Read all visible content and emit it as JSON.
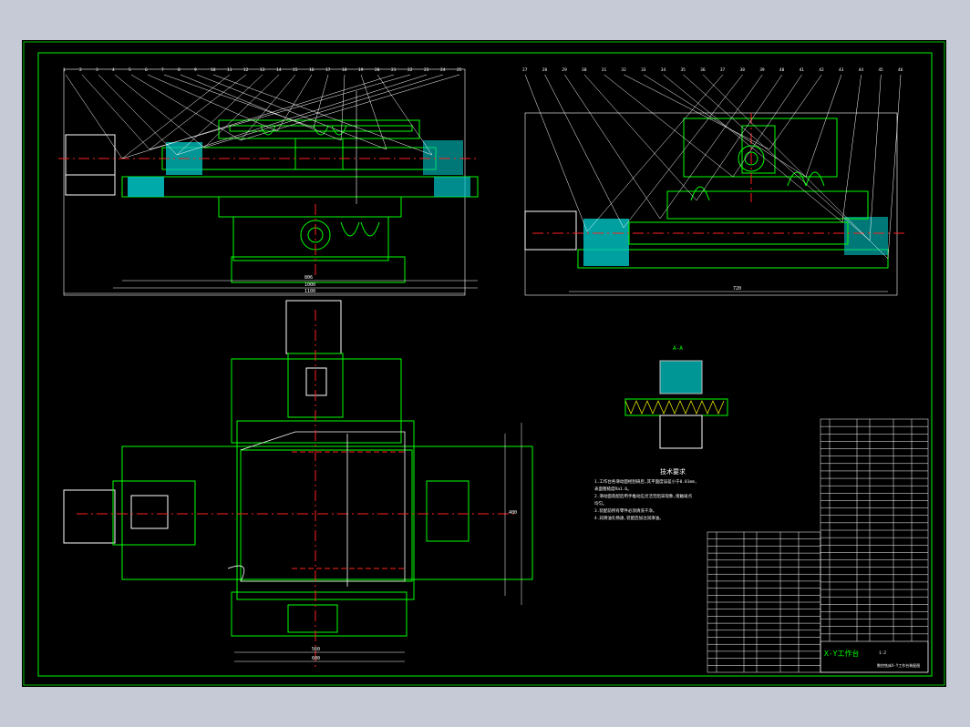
{
  "drawing": {
    "tech_requirements": {
      "heading": "技术要求",
      "lines": [
        "1.工作台各滑动面经刮研后,其平面度误差小于0.01mm,",
        "表面粗糙度Ra1.6。",
        "2.滑动面装配后用手推动应灵活无阻滞现象,接触斑点",
        "均匀。",
        "3.装配前所有零件必须清洗干净。",
        "4.润滑油孔畅通,装配后加注润滑油。"
      ]
    },
    "detail_label": "A-A",
    "dimensions": {
      "top_left_a": "806",
      "top_left_b": "1000",
      "top_left_c": "1100",
      "top_right": "720",
      "plan_width_a": "560",
      "plan_width_b": "600",
      "plan_height": "400"
    },
    "title_block": {
      "title": "X-Y工作台",
      "scale": "1:2",
      "drawing_name": "数控铣床X-Y工作台装配图"
    },
    "callouts_left": [
      "1",
      "2",
      "3",
      "4",
      "5",
      "6",
      "7",
      "8",
      "9",
      "10",
      "11",
      "12",
      "13",
      "14",
      "15",
      "16",
      "17",
      "18",
      "19",
      "20",
      "21",
      "22",
      "23",
      "24",
      "25"
    ],
    "callouts_right": [
      "27",
      "28",
      "29",
      "30",
      "31",
      "32",
      "33",
      "34",
      "35",
      "36",
      "37",
      "38",
      "39",
      "40",
      "41",
      "42",
      "43",
      "44",
      "45",
      "46"
    ]
  },
  "colors": {
    "background": "#000000",
    "frame": "#00c000",
    "outline": "#ffffff",
    "parts": "#00ff00",
    "section": "#00c8c8",
    "centerline": "#ff2020",
    "dimension": "#ffffff",
    "highlight": "#ffff00"
  }
}
